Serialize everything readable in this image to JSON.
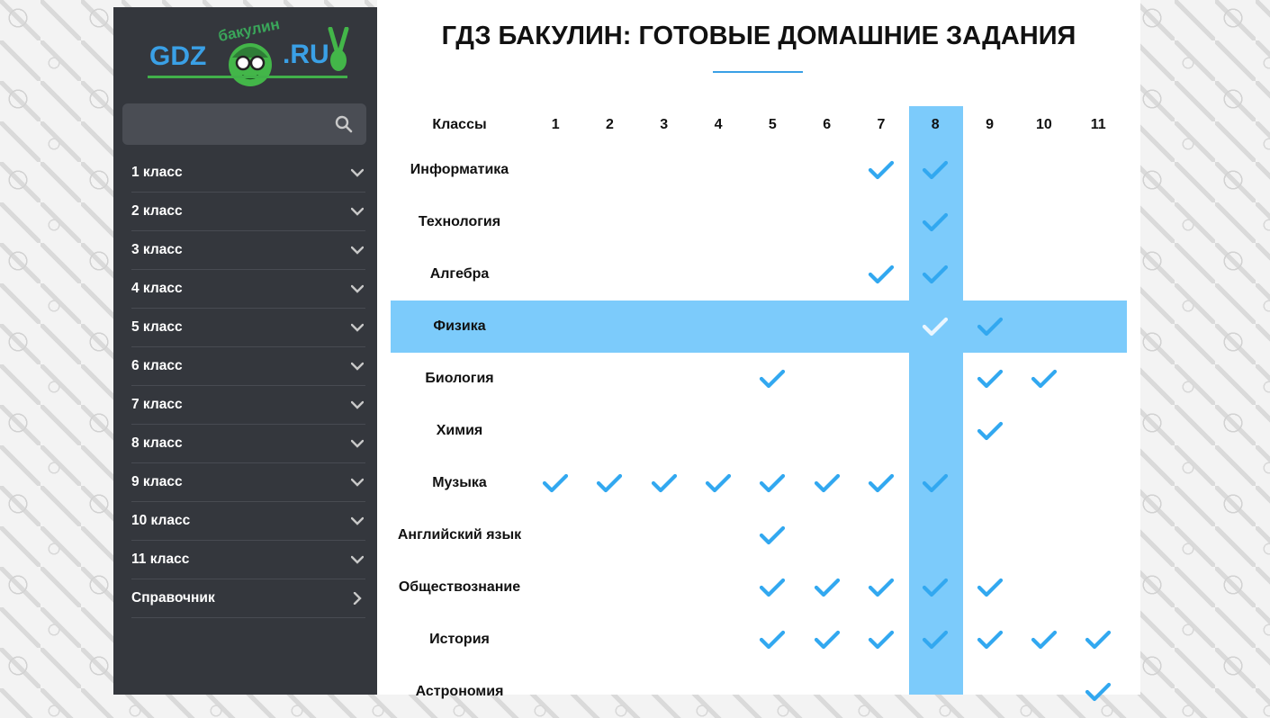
{
  "logo": {
    "left": "GDZ",
    "top": "бакулин",
    "right": ".RU"
  },
  "search": {
    "placeholder": ""
  },
  "sidebar": {
    "items": [
      {
        "label": "1 класс",
        "arrow": "chevron-down"
      },
      {
        "label": "2 класс",
        "arrow": "chevron-down"
      },
      {
        "label": "3 класс",
        "arrow": "chevron-down"
      },
      {
        "label": "4 класс",
        "arrow": "chevron-down"
      },
      {
        "label": "5 класс",
        "arrow": "chevron-down"
      },
      {
        "label": "6 класс",
        "arrow": "chevron-down"
      },
      {
        "label": "7 класс",
        "arrow": "chevron-down"
      },
      {
        "label": "8 класс",
        "arrow": "chevron-down"
      },
      {
        "label": "9 класс",
        "arrow": "chevron-down"
      },
      {
        "label": "10 класс",
        "arrow": "chevron-down"
      },
      {
        "label": "11 класс",
        "arrow": "chevron-down"
      },
      {
        "label": "Справочник",
        "arrow": "chevron-right"
      }
    ]
  },
  "page": {
    "title": "ГДЗ БАКУЛИН: ГОТОВЫЕ ДОМАШНИЕ ЗАДАНИЯ"
  },
  "table": {
    "header_label": "Классы",
    "classes": [
      "1",
      "2",
      "3",
      "4",
      "5",
      "6",
      "7",
      "8",
      "9",
      "10",
      "11"
    ],
    "highlighted_class": "8",
    "highlighted_subject": "Физика",
    "rows": [
      {
        "subject": "Информатика",
        "classes": [
          "7",
          "8"
        ]
      },
      {
        "subject": "Технология",
        "classes": [
          "8"
        ]
      },
      {
        "subject": "Алгебра",
        "classes": [
          "7",
          "8"
        ]
      },
      {
        "subject": "Физика",
        "classes": [
          "8",
          "9"
        ]
      },
      {
        "subject": "Биология",
        "classes": [
          "5",
          "9",
          "10"
        ]
      },
      {
        "subject": "Химия",
        "classes": [
          "9"
        ]
      },
      {
        "subject": "Музыка",
        "classes": [
          "1",
          "2",
          "3",
          "4",
          "5",
          "6",
          "7",
          "8"
        ]
      },
      {
        "subject": "Английский язык",
        "classes": [
          "5"
        ]
      },
      {
        "subject": "Обществознание",
        "classes": [
          "5",
          "6",
          "7",
          "8",
          "9"
        ]
      },
      {
        "subject": "История",
        "classes": [
          "5",
          "6",
          "7",
          "8",
          "9",
          "10",
          "11"
        ]
      },
      {
        "subject": "Астрономия",
        "classes": [
          "11"
        ]
      }
    ]
  },
  "colors": {
    "accent": "#3aa0e6",
    "check": "#32a8f0",
    "check_on_highlight": "#eaf6ff",
    "highlight": "#7ccbfb",
    "sidebar_bg": "#34373d",
    "logo_green": "#41b04a"
  }
}
